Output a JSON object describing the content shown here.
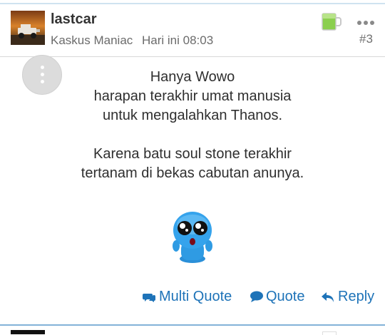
{
  "post": {
    "username": "lastcar",
    "rank": "Kaskus Maniac",
    "time": "Hari ini 08:03",
    "number": "#3",
    "avatar_icon": "jeep-avatar",
    "badge_icon": "green-beer-mug-icon",
    "menu_icon": "more-dots-icon",
    "float_menu_icon": "vertical-dots-icon"
  },
  "content": {
    "lines": [
      "Hanya Wowo",
      "harapan terakhir umat manusia",
      "untuk mengalahkan Thanos.",
      "",
      "Karena batu soul stone terakhir",
      "tertanam di bekas cabutan anunya."
    ],
    "emoticon": "blue-puppy-eyes-emoticon"
  },
  "actions": {
    "multi_quote": "Multi Quote",
    "quote": "Quote",
    "reply": "Reply"
  },
  "colors": {
    "link": "#1e73b8",
    "text": "#2f2f2f",
    "meta": "#6b6b6b",
    "badge": "#7cc14a"
  }
}
